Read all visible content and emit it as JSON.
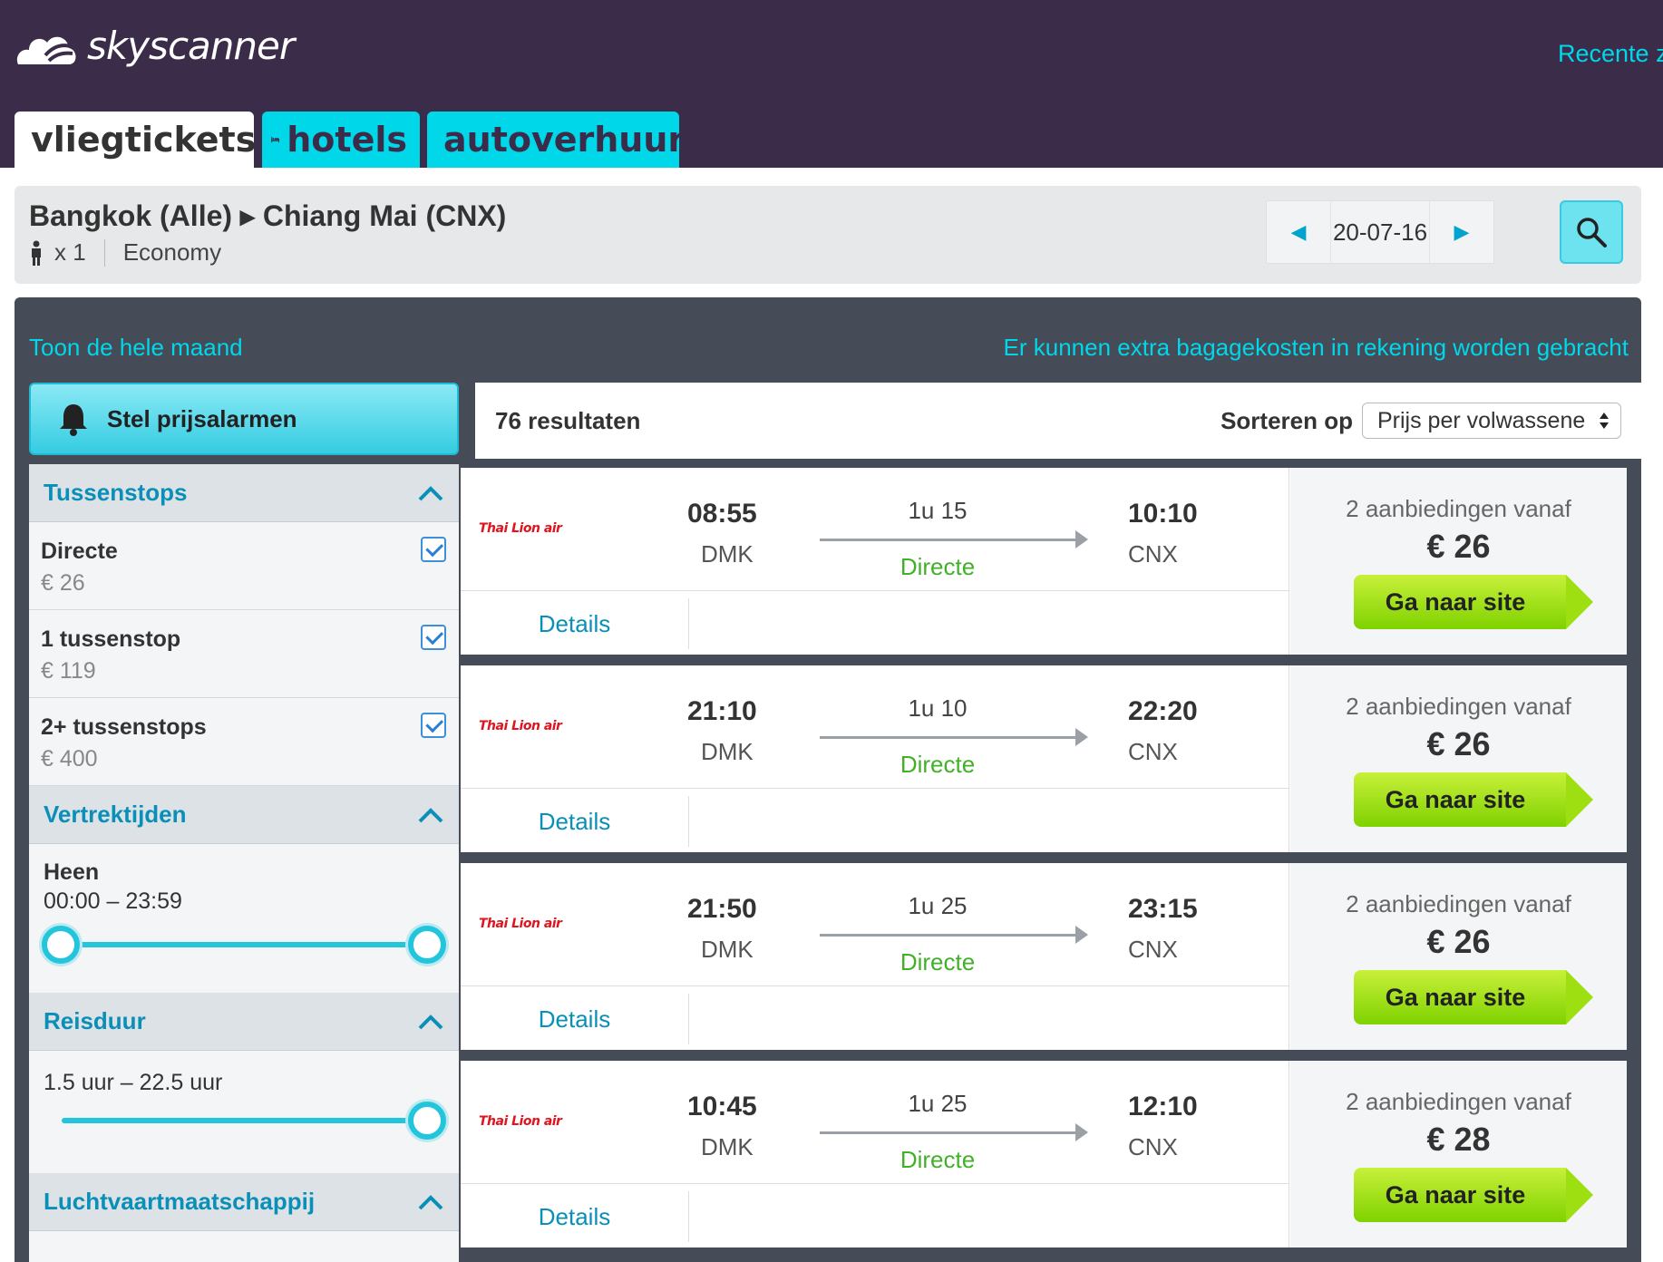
{
  "header": {
    "logo_text": "skyscanner",
    "recent_link": "Recente z"
  },
  "tabs": [
    {
      "label": "vliegtickets",
      "icon": "plane-icon",
      "active": true
    },
    {
      "label": "hotels",
      "icon": "bed-icon",
      "active": false
    },
    {
      "label": "autoverhuur",
      "icon": "car-icon",
      "active": false
    }
  ],
  "search": {
    "route": "Bangkok (Alle) ▸ Chiang Mai (CNX)",
    "passengers": "x 1",
    "cabin": "Economy",
    "date": "20-07-16"
  },
  "links": {
    "month": "Toon de hele maand",
    "baggage": "Er kunnen extra bagagekosten in rekening worden gebracht"
  },
  "sidebar": {
    "alarm_label": "Stel prijsalarmen",
    "stops_title": "Tussenstops",
    "stops": [
      {
        "label": "Directe",
        "price": "€ 26",
        "checked": true
      },
      {
        "label": "1 tussenstop",
        "price": "€ 119",
        "checked": true
      },
      {
        "label": "2+ tussenstops",
        "price": "€ 400",
        "checked": true
      }
    ],
    "departure_title": "Vertrektijden",
    "departure_label": "Heen",
    "departure_range": "00:00 – 23:59",
    "duration_title": "Reisduur",
    "duration_range": "1.5 uur – 22.5 uur",
    "airline_title": "Luchtvaartmaatschappij"
  },
  "results": {
    "count": "76 resultaten",
    "sort_label": "Sorteren op",
    "sort_value": "Prijs per volwassene",
    "details_label": "Details",
    "go_label": "Ga naar site",
    "items": [
      {
        "airline": "Thai Lion air",
        "dep_time": "08:55",
        "dep_airport": "DMK",
        "duration": "1u 15",
        "stops": "Directe",
        "arr_time": "10:10",
        "arr_airport": "CNX",
        "offers": "2 aanbiedingen vanaf",
        "price": "€ 26"
      },
      {
        "airline": "Thai Lion air",
        "dep_time": "21:10",
        "dep_airport": "DMK",
        "duration": "1u 10",
        "stops": "Directe",
        "arr_time": "22:20",
        "arr_airport": "CNX",
        "offers": "2 aanbiedingen vanaf",
        "price": "€ 26"
      },
      {
        "airline": "Thai Lion air",
        "dep_time": "21:50",
        "dep_airport": "DMK",
        "duration": "1u 25",
        "stops": "Directe",
        "arr_time": "23:15",
        "arr_airport": "CNX",
        "offers": "2 aanbiedingen vanaf",
        "price": "€ 26"
      },
      {
        "airline": "Thai Lion air",
        "dep_time": "10:45",
        "dep_airport": "DMK",
        "duration": "1u 25",
        "stops": "Directe",
        "arr_time": "12:10",
        "arr_airport": "CNX",
        "offers": "2 aanbiedingen vanaf",
        "price": "€ 28"
      }
    ]
  },
  "colors": {
    "header_bg": "#3b2d4a",
    "accent": "#00d7e9",
    "link": "#0a8fb8",
    "direct": "#43b02a",
    "cta": "#9edf12",
    "airline_red": "#e0141e"
  }
}
